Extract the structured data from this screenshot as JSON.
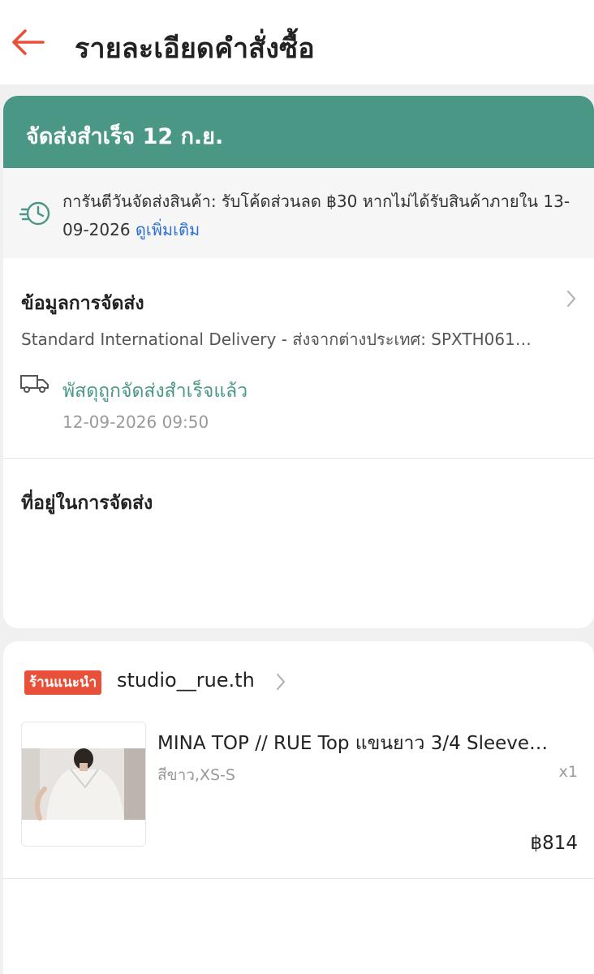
{
  "header": {
    "title": "รายละเอียดคำสั่งซื้อ",
    "back_icon": "arrow-left-icon",
    "accent_color": "#e8503a"
  },
  "status": {
    "text": "จัดส่งสำเร็จ 12 ก.ย.",
    "color": "#4a9785"
  },
  "guarantee": {
    "text": "การันตีวันจัดส่งสินค้า: รับโค้ดส่วนลด ฿30 หากไม่ได้รับสินค้าภายใน 13-09-2026 ",
    "link": "ดูเพิ่มเติม",
    "icon": "clock-fast-icon"
  },
  "shipping": {
    "title": "ข้อมูลการจัดส่ง",
    "method": "Standard International Delivery - ส่งจากต่างประเทศ: SPXTH061…",
    "status": "พัสดุถูกจัดส่งสำเร็จแล้ว",
    "time": "12-09-2026 09:50",
    "icon": "truck-icon"
  },
  "address": {
    "title": "ที่อยู่ในการจัดส่ง"
  },
  "shop": {
    "badge": "ร้านแนะนำ",
    "name": "studio__rue.th",
    "badge_color": "#e8503a"
  },
  "product": {
    "name": "MINA TOP // RUE Top แขนยาว 3/4 Sleeve…",
    "variant": "สีขาว,XS-S",
    "qty": "x1",
    "price": "฿814"
  }
}
